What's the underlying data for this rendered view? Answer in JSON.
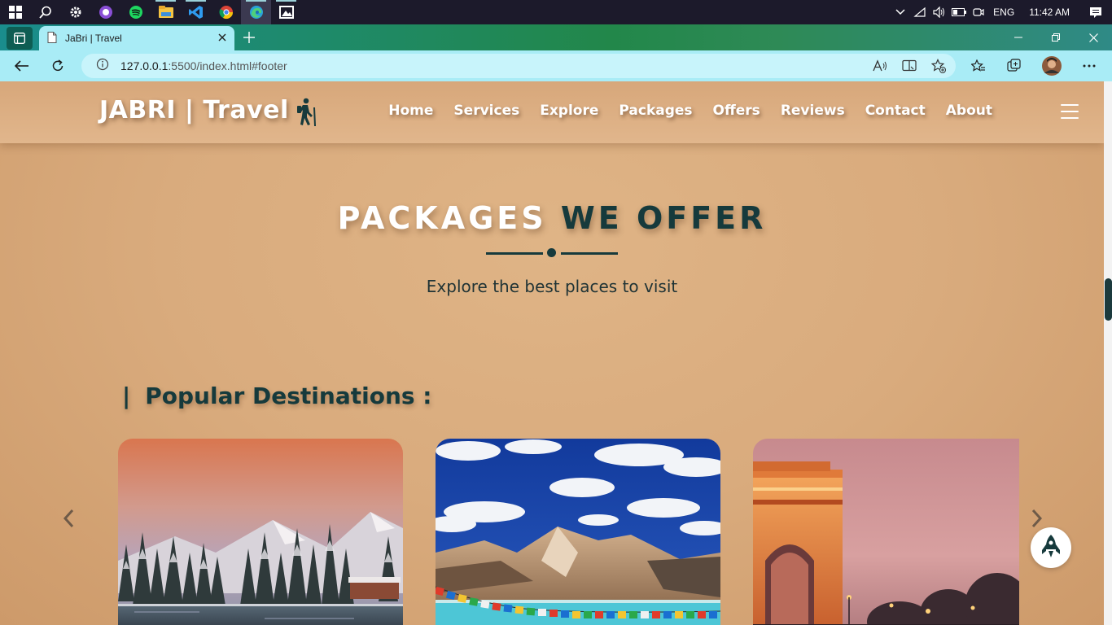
{
  "taskbar": {
    "icons": [
      "windows-start-icon",
      "search-icon",
      "settings-icon",
      "github-icon",
      "spotify-icon",
      "file-explorer-icon",
      "vscode-icon",
      "chrome-icon",
      "edge-icon",
      "photos-icon"
    ],
    "tray": {
      "language": "ENG",
      "time": "11:42 AM"
    }
  },
  "browser": {
    "tab": {
      "title": "JaBri | Travel"
    },
    "url": {
      "host": "127.0.0.1",
      "rest": ":5500/index.html#footer"
    }
  },
  "site": {
    "logo": "JABRI | Travel",
    "menu": [
      "Home",
      "Services",
      "Explore",
      "Packages",
      "Offers",
      "Reviews",
      "Contact",
      "About"
    ],
    "section": {
      "title_part1": "PACKAGES",
      "title_part2": "WE OFFER",
      "subtitle": "Explore the best places to visit"
    },
    "popular": {
      "bar": "|",
      "heading": "Popular Destinations :"
    }
  },
  "colors": {
    "accent": "#163a3c",
    "page_bg": "#d9ab7d",
    "tab_bg": "#a9ecf6"
  }
}
